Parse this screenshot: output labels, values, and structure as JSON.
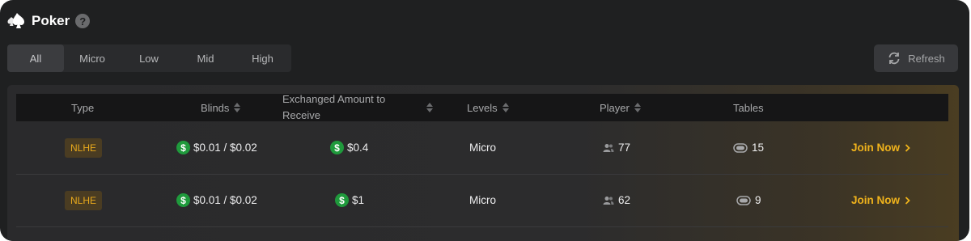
{
  "header": {
    "title": "Poker",
    "help_icon": "question-icon",
    "help_label": "?"
  },
  "filters": {
    "items": [
      "All",
      "Micro",
      "Low",
      "Mid",
      "High"
    ],
    "active": "All"
  },
  "toolbar": {
    "refresh_label": "Refresh"
  },
  "table": {
    "columns": {
      "type": "Type",
      "blinds": "Blinds",
      "exchanged": "Exchanged Amount to Receive",
      "levels": "Levels",
      "player": "Player",
      "tables": "Tables"
    },
    "rows": [
      {
        "type": "NLHE",
        "blinds": "$0.01 / $0.02",
        "exchanged": "$0.4",
        "level": "Micro",
        "players": "77",
        "tables": "15",
        "action": "Join Now"
      },
      {
        "type": "NLHE",
        "blinds": "$0.01 / $0.02",
        "exchanged": "$1",
        "level": "Micro",
        "players": "62",
        "tables": "9",
        "action": "Join Now"
      }
    ]
  },
  "colors": {
    "accent": "#f0b31c",
    "coin": "#1f9a3c",
    "badge_bg": "#4a3c22"
  }
}
